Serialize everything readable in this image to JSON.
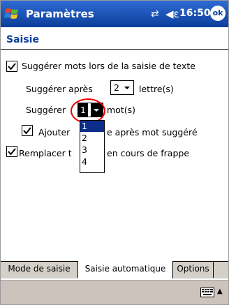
{
  "titlebar": {
    "app_title": "Paramètres",
    "time": "16:50",
    "ok_label": "ok",
    "connectivity_icon": "connectivity-icon",
    "volume_icon": "speaker-icon",
    "start_icon": "windows-start-icon"
  },
  "header": {
    "title": "Saisie"
  },
  "options": {
    "suggest_words_label": "Suggérer mots lors de la saisie de texte",
    "suggest_words_checked": true,
    "suggest_after_label": "Suggérer après",
    "suggest_after_value": "2",
    "suggest_after_unit": "lettre(s)",
    "suggest_label": "Suggérer",
    "suggest_value": "1",
    "suggest_unit": "mot(s)",
    "add_space_label_a": "Ajouter",
    "add_space_label_b": "e après mot suggéré",
    "add_space_checked": true,
    "replace_label_a": "Remplacer t",
    "replace_label_b": "en cours de frappe",
    "replace_checked": true
  },
  "dropdown": {
    "options": [
      "1",
      "2",
      "3",
      "4"
    ],
    "selected_index": 0
  },
  "tabs": {
    "items": [
      "Mode de saisie",
      "Saisie automatique",
      "Options"
    ],
    "active_index": 1
  },
  "bottombar": {
    "keyboard_icon": "keyboard-icon",
    "sip_icon": "sip-up-arrow-icon"
  }
}
